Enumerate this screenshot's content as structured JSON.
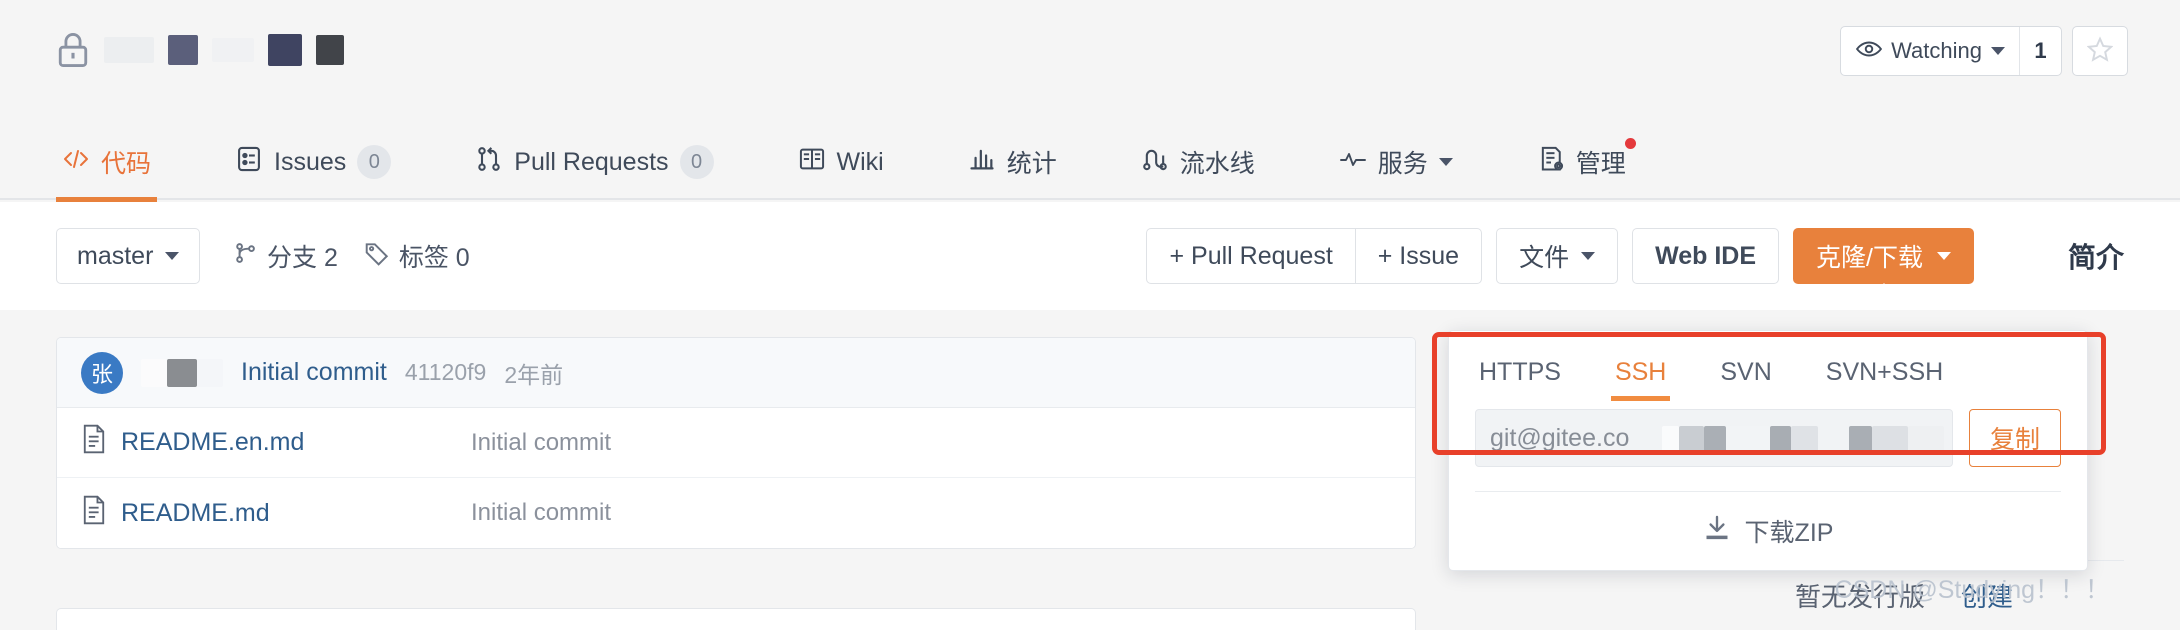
{
  "header": {
    "lock_icon": "lock-icon",
    "repo_name_redacted": true,
    "watch": {
      "label": "Watching",
      "count": "1",
      "eye_icon": "eye-icon",
      "caret_icon": "chevron-down-icon"
    },
    "star": {
      "star_icon": "star-icon"
    }
  },
  "nav": {
    "tabs": [
      {
        "label": "代码",
        "icon": "code-icon",
        "badge": "",
        "active": true,
        "caret": false,
        "dot": false
      },
      {
        "label": "Issues",
        "icon": "issue-icon",
        "badge": "0",
        "active": false,
        "caret": false,
        "dot": false
      },
      {
        "label": "Pull Requests",
        "icon": "pull-request-icon",
        "badge": "0",
        "active": false,
        "caret": false,
        "dot": false
      },
      {
        "label": "Wiki",
        "icon": "book-icon",
        "badge": "",
        "active": false,
        "caret": false,
        "dot": false
      },
      {
        "label": "统计",
        "icon": "chart-icon",
        "badge": "",
        "active": false,
        "caret": false,
        "dot": false
      },
      {
        "label": "流水线",
        "icon": "pipeline-icon",
        "badge": "",
        "active": false,
        "caret": false,
        "dot": false
      },
      {
        "label": "服务",
        "icon": "pulse-icon",
        "badge": "",
        "active": false,
        "caret": true,
        "dot": false
      },
      {
        "label": "管理",
        "icon": "settings-doc-icon",
        "badge": "",
        "active": false,
        "caret": false,
        "dot": true
      }
    ]
  },
  "toolbar": {
    "branch": "master",
    "branch_caret": "chevron-down-icon",
    "branches_label": "分支 2",
    "branches_icon": "branch-icon",
    "tags_label": "标签 0",
    "tags_icon": "tag-icon",
    "pull_request_button": "+ Pull Request",
    "issue_button": "+ Issue",
    "files_button": "文件",
    "files_caret": "chevron-down-icon",
    "webide_button": "Web IDE",
    "clone_button": "克隆/下载",
    "clone_caret": "chevron-down-icon",
    "intro_title": "简介"
  },
  "files": {
    "commit": {
      "avatar_initial": "张",
      "message": "Initial commit",
      "hash": "41120f9",
      "time": "2年前"
    },
    "rows": [
      {
        "name": "README.en.md",
        "icon": "file-icon",
        "commit": "Initial commit"
      },
      {
        "name": "README.md",
        "icon": "file-icon",
        "commit": "Initial commit"
      }
    ]
  },
  "release": {
    "empty_text": "暂无发行版",
    "create_link": "创建"
  },
  "clone_panel": {
    "tabs": [
      {
        "label": "HTTPS",
        "active": false
      },
      {
        "label": "SSH",
        "active": true
      },
      {
        "label": "SVN",
        "active": false
      },
      {
        "label": "SVN+SSH",
        "active": false
      }
    ],
    "url_value": "git@gitee.co",
    "copy_button": "复制",
    "download_zip": "下载ZIP",
    "download_icon": "download-icon"
  },
  "watermark": "CSDN @Studying！！！",
  "colors": {
    "accent_orange": "#e8813c",
    "annotation_red": "#e8402a",
    "link_blue": "#2f5d8c",
    "text_dark": "#3f4a5a",
    "page_bg": "#f5f5f5"
  }
}
